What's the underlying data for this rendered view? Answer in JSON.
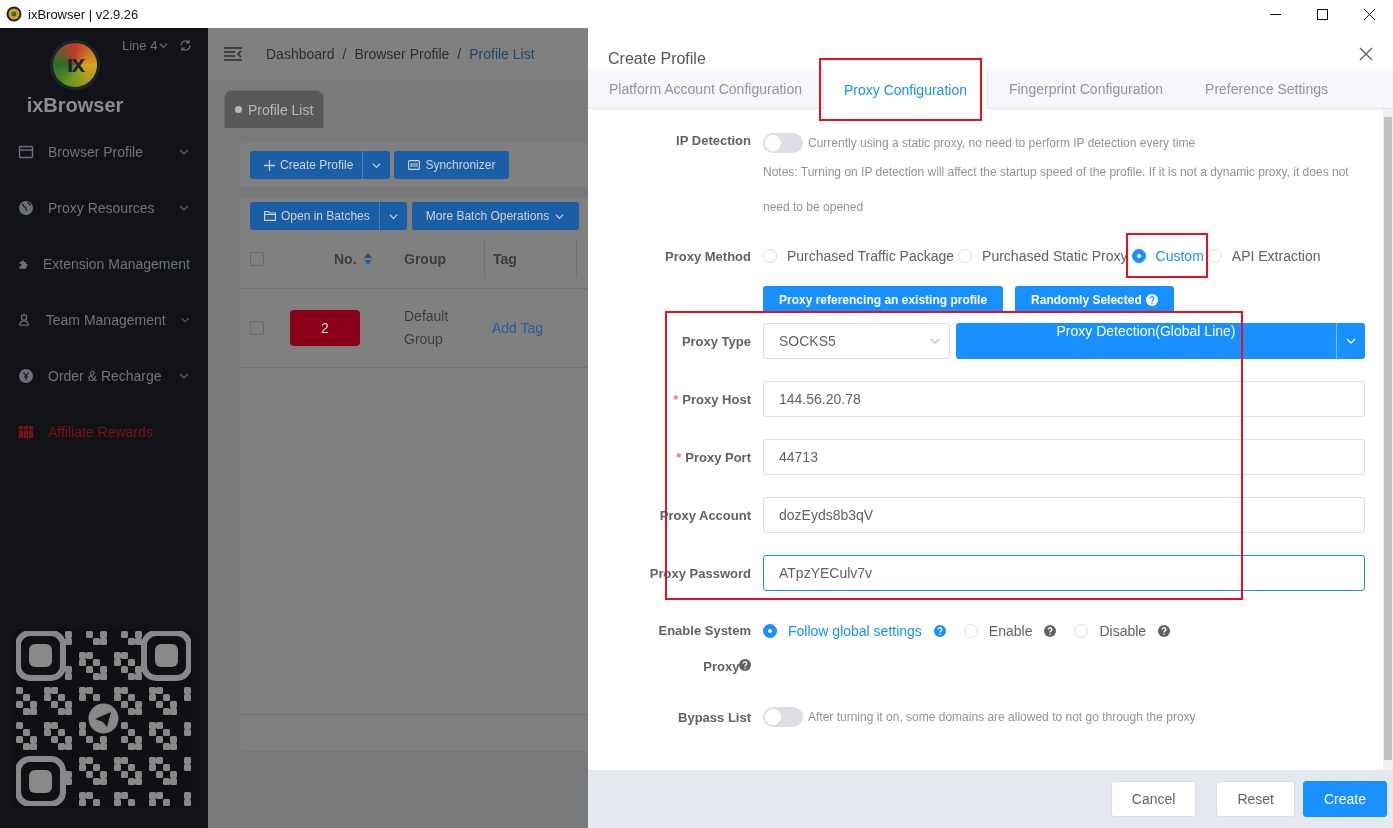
{
  "window": {
    "title": "ixBrowser | v2.9.26"
  },
  "sidebar": {
    "logo_mark": "IX",
    "brand": "ixBrowser",
    "line": "Line 4",
    "items": [
      {
        "label": "Browser Profile",
        "kind": "menu"
      },
      {
        "label": "Proxy Resources",
        "kind": "menu"
      },
      {
        "label": "Extension Management",
        "kind": "plain"
      },
      {
        "label": "Team Management",
        "kind": "menu"
      },
      {
        "label": "Order & Recharge",
        "kind": "menu"
      },
      {
        "label": "Affiliate Rewards",
        "kind": "promo"
      }
    ]
  },
  "main": {
    "breadcrumb": [
      "Dashboard",
      "Browser Profile",
      "Profile List"
    ],
    "breadcrumb_separator": "/",
    "tabs": [
      {
        "label": "Profile List",
        "selected": true
      }
    ],
    "toolbar": [
      {
        "label": "Create Profile",
        "split": true
      },
      {
        "label": "Synchronizer",
        "split": false
      }
    ],
    "batch_toolbar": [
      {
        "label": "Open in Batches",
        "split": true
      },
      {
        "label": "More Batch Operations",
        "split": false
      }
    ],
    "table": {
      "columns": [
        "No.",
        "Group",
        "Tag"
      ],
      "all_checked": false,
      "rows": [
        {
          "checked": false,
          "no": "2",
          "group": "Default Group",
          "tag": "Add Tag"
        }
      ]
    }
  },
  "dialog": {
    "title": "Create Profile",
    "tabs": [
      {
        "label": "Platform Account Configuration",
        "selected": false,
        "highlighted": false
      },
      {
        "label": "Proxy Configuration",
        "selected": true,
        "highlighted": true
      },
      {
        "label": "Fingerprint Configuration",
        "selected": false,
        "highlighted": false
      },
      {
        "label": "Preference Settings",
        "selected": false,
        "highlighted": false
      }
    ],
    "ip_detection": {
      "label": "IP Detection",
      "on": false,
      "hint": "Currently using a static proxy, no need to perform IP detection every time",
      "note": "Notes: Turning on IP detection will affect the startup speed of the profile. If it is not a dynamic proxy, it does not need to be opened"
    },
    "proxy_method": {
      "label": "Proxy Method",
      "options": [
        {
          "label": "Purchased Traffic Package",
          "selected": false,
          "highlighted": false
        },
        {
          "label": "Purchased Static Proxy",
          "selected": false,
          "highlighted": false
        },
        {
          "label": "Custom",
          "selected": true,
          "highlighted": true
        },
        {
          "label": "API Extraction",
          "selected": false,
          "highlighted": false
        }
      ],
      "buttons": [
        {
          "label": "Proxy referencing an existing profile",
          "help": false
        },
        {
          "label": "Randomly Selected",
          "help": true
        }
      ]
    },
    "proxy_fields": {
      "highlighted": true,
      "type_label": "Proxy Type",
      "type_value": "SOCKS5",
      "detect_button": "Proxy Detection(Global Line)",
      "fields": [
        {
          "label": "Proxy Host",
          "required": true,
          "required_mark": "*",
          "value": "144.56.20.78",
          "focused": false
        },
        {
          "label": "Proxy Port",
          "required": true,
          "required_mark": "*",
          "value": "44713",
          "focused": false
        },
        {
          "label": "Proxy Account",
          "required": false,
          "value": "dozEyds8b3qV",
          "focused": false
        },
        {
          "label": "Proxy Password",
          "required": false,
          "value": "ATpzYECulv7v",
          "focused": true
        }
      ]
    },
    "system_proxy": {
      "label": "Enable System Proxy",
      "options": [
        {
          "label": "Follow global settings",
          "selected": true
        },
        {
          "label": "Enable",
          "selected": false
        },
        {
          "label": "Disable",
          "selected": false
        }
      ]
    },
    "bypass": {
      "label": "Bypass List",
      "on": false,
      "hint": "After turning it on, some domains are allowed to not go through the proxy"
    },
    "footer": [
      {
        "label": "Cancel",
        "kind": "default"
      },
      {
        "label": "Reset",
        "kind": "default"
      },
      {
        "label": "Create",
        "kind": "primary"
      }
    ]
  }
}
